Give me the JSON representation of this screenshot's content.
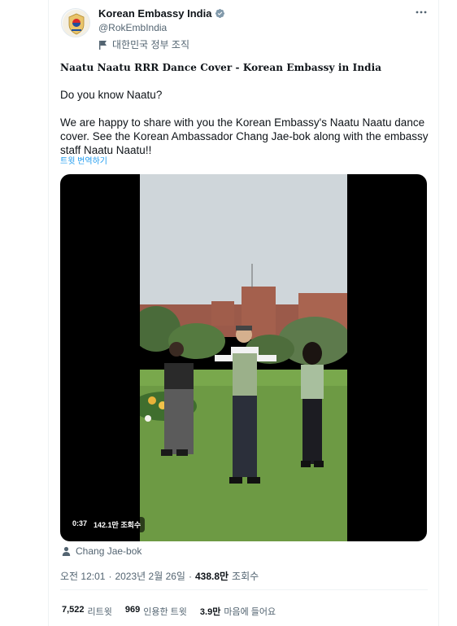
{
  "author": {
    "display_name": "Korean Embassy India",
    "handle": "@RokEmbIndia",
    "affiliation": "대한민국 정부 조직"
  },
  "tweet": {
    "title": "Naatu Naatu RRR Dance Cover - Korean Embassy in India",
    "paragraph_1": "Do you know Naatu?",
    "paragraph_2": "We are happy to share with you the Korean Embassy's Naatu Naatu dance cover. See the Korean Ambassador Chang Jae-bok along with the embassy staff Naatu Naatu!!",
    "translate_label": "트윗 번역하기"
  },
  "video": {
    "duration": "0:37",
    "views": "142.1만 조회수"
  },
  "tagged_user": "Chang Jae-bok",
  "meta": {
    "time": "오전 12:01",
    "separator_1": "·",
    "date": "2023년 2월 26일",
    "separator_2": "·",
    "views_count": "438.8만",
    "views_label": "조회수"
  },
  "stats": {
    "retweets_count": "7,522",
    "retweets_label": "리트윗",
    "quotes_count": "969",
    "quotes_label": "인용한 트윗",
    "likes_count": "3.9만",
    "likes_label": "마음에 들어요"
  },
  "colors": {
    "accent": "#1d9bf0",
    "secondary_text": "#536471",
    "primary_text": "#0f1419"
  }
}
